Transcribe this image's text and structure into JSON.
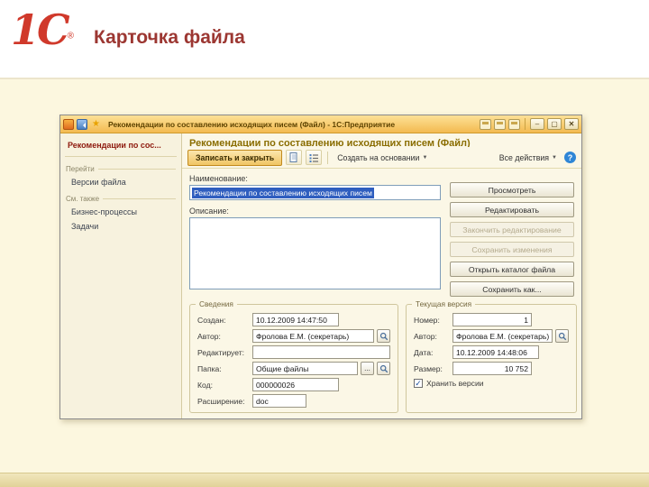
{
  "slide": {
    "logo_text": "1С",
    "logo_reg": "®",
    "title": "Карточка файла"
  },
  "icons": {
    "caret": "▼",
    "star": "★",
    "ellipsis": "...",
    "check": "✓"
  },
  "window": {
    "titlebar": {
      "title": "Рекомендации по составлению исходящих писем (Файл) - 1С:Предприятие",
      "min": "–",
      "max": "▢",
      "close": "✕"
    },
    "sidebar": {
      "header": "Рекомендации по сос...",
      "nav_label": "Перейти",
      "nav_items": [
        "Версии файла"
      ],
      "see_also_label": "См. также",
      "see_also_items": [
        "Бизнес-процессы",
        "Задачи"
      ]
    },
    "form": {
      "title": "Рекомендации по составлению исходящих писем (Файл)",
      "toolbar": {
        "save_close": "Записать и закрыть",
        "create_from": "Создать на основании",
        "all_actions": "Все действия",
        "help": "?"
      },
      "name": {
        "label": "Наименование:",
        "value": "Рекомендации по составлению исходящих писем"
      },
      "description": {
        "label": "Описание:",
        "value": ""
      },
      "actions": [
        {
          "label": "Просмотреть",
          "enabled": true
        },
        {
          "label": "Редактировать",
          "enabled": true
        },
        {
          "label": "Закончить редактирование",
          "enabled": false
        },
        {
          "label": "Сохранить изменения",
          "enabled": false
        },
        {
          "label": "Открыть каталог файла",
          "enabled": true
        },
        {
          "label": "Сохранить как...",
          "enabled": true
        }
      ],
      "info": {
        "legend": "Сведения",
        "created_label": "Создан:",
        "created_value": "10.12.2009 14:47:50",
        "author_label": "Автор:",
        "author_value": "Фролова Е.М. (секретарь)",
        "editing_label": "Редактирует:",
        "editing_value": "",
        "folder_label": "Папка:",
        "folder_value": "Общие файлы",
        "code_label": "Код:",
        "code_value": "000000026",
        "ext_label": "Расширение:",
        "ext_value": "doc"
      },
      "version": {
        "legend": "Текущая версия",
        "number_label": "Номер:",
        "number_value": "1",
        "author_label": "Автор:",
        "author_value": "Фролова Е.М. (секретарь)",
        "date_label": "Дата:",
        "date_value": "10.12.2009 14:48:06",
        "size_label": "Размер:",
        "size_value": "10 752",
        "keep_versions_label": "Хранить версии"
      }
    }
  }
}
